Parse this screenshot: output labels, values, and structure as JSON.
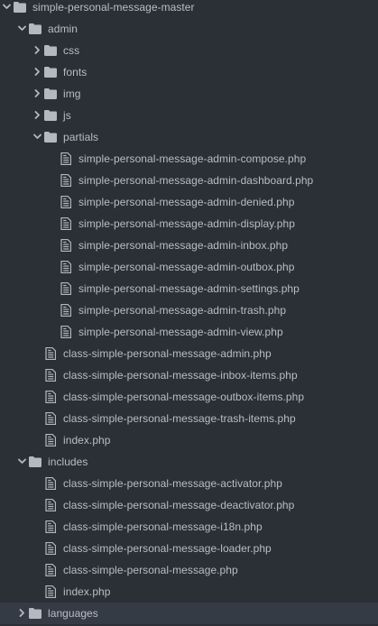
{
  "tree": [
    {
      "label": "simple-personal-message-master",
      "type": "folder",
      "depth": 0,
      "expanded": true
    },
    {
      "label": "admin",
      "type": "folder",
      "depth": 1,
      "expanded": true
    },
    {
      "label": "css",
      "type": "folder",
      "depth": 2,
      "expanded": false
    },
    {
      "label": "fonts",
      "type": "folder",
      "depth": 2,
      "expanded": false
    },
    {
      "label": "img",
      "type": "folder",
      "depth": 2,
      "expanded": false
    },
    {
      "label": "js",
      "type": "folder",
      "depth": 2,
      "expanded": false
    },
    {
      "label": "partials",
      "type": "folder",
      "depth": 2,
      "expanded": true
    },
    {
      "label": "simple-personal-message-admin-compose.php",
      "type": "file",
      "depth": 3
    },
    {
      "label": "simple-personal-message-admin-dashboard.php",
      "type": "file",
      "depth": 3
    },
    {
      "label": "simple-personal-message-admin-denied.php",
      "type": "file",
      "depth": 3
    },
    {
      "label": "simple-personal-message-admin-display.php",
      "type": "file",
      "depth": 3
    },
    {
      "label": "simple-personal-message-admin-inbox.php",
      "type": "file",
      "depth": 3
    },
    {
      "label": "simple-personal-message-admin-outbox.php",
      "type": "file",
      "depth": 3
    },
    {
      "label": "simple-personal-message-admin-settings.php",
      "type": "file",
      "depth": 3
    },
    {
      "label": "simple-personal-message-admin-trash.php",
      "type": "file",
      "depth": 3
    },
    {
      "label": "simple-personal-message-admin-view.php",
      "type": "file",
      "depth": 3
    },
    {
      "label": "class-simple-personal-message-admin.php",
      "type": "file",
      "depth": 2
    },
    {
      "label": "class-simple-personal-message-inbox-items.php",
      "type": "file",
      "depth": 2
    },
    {
      "label": "class-simple-personal-message-outbox-items.php",
      "type": "file",
      "depth": 2
    },
    {
      "label": "class-simple-personal-message-trash-items.php",
      "type": "file",
      "depth": 2
    },
    {
      "label": "index.php",
      "type": "file",
      "depth": 2
    },
    {
      "label": "includes",
      "type": "folder",
      "depth": 1,
      "expanded": true
    },
    {
      "label": "class-simple-personal-message-activator.php",
      "type": "file",
      "depth": 2
    },
    {
      "label": "class-simple-personal-message-deactivator.php",
      "type": "file",
      "depth": 2
    },
    {
      "label": "class-simple-personal-message-i18n.php",
      "type": "file",
      "depth": 2
    },
    {
      "label": "class-simple-personal-message-loader.php",
      "type": "file",
      "depth": 2
    },
    {
      "label": "class-simple-personal-message.php",
      "type": "file",
      "depth": 2
    },
    {
      "label": "index.php",
      "type": "file",
      "depth": 2
    },
    {
      "label": "languages",
      "type": "folder",
      "depth": 1,
      "expanded": false,
      "highlighted": true
    }
  ],
  "colors": {
    "background": "#2b2f36",
    "highlight": "#353b44",
    "text": "#b9bec6",
    "icon": "#b4b9c1",
    "file_fold": "#2b2f36"
  },
  "icons": {
    "folder": "folder-icon",
    "file": "file-icon",
    "expanded": "chevron-down-icon",
    "collapsed": "chevron-right-icon"
  }
}
